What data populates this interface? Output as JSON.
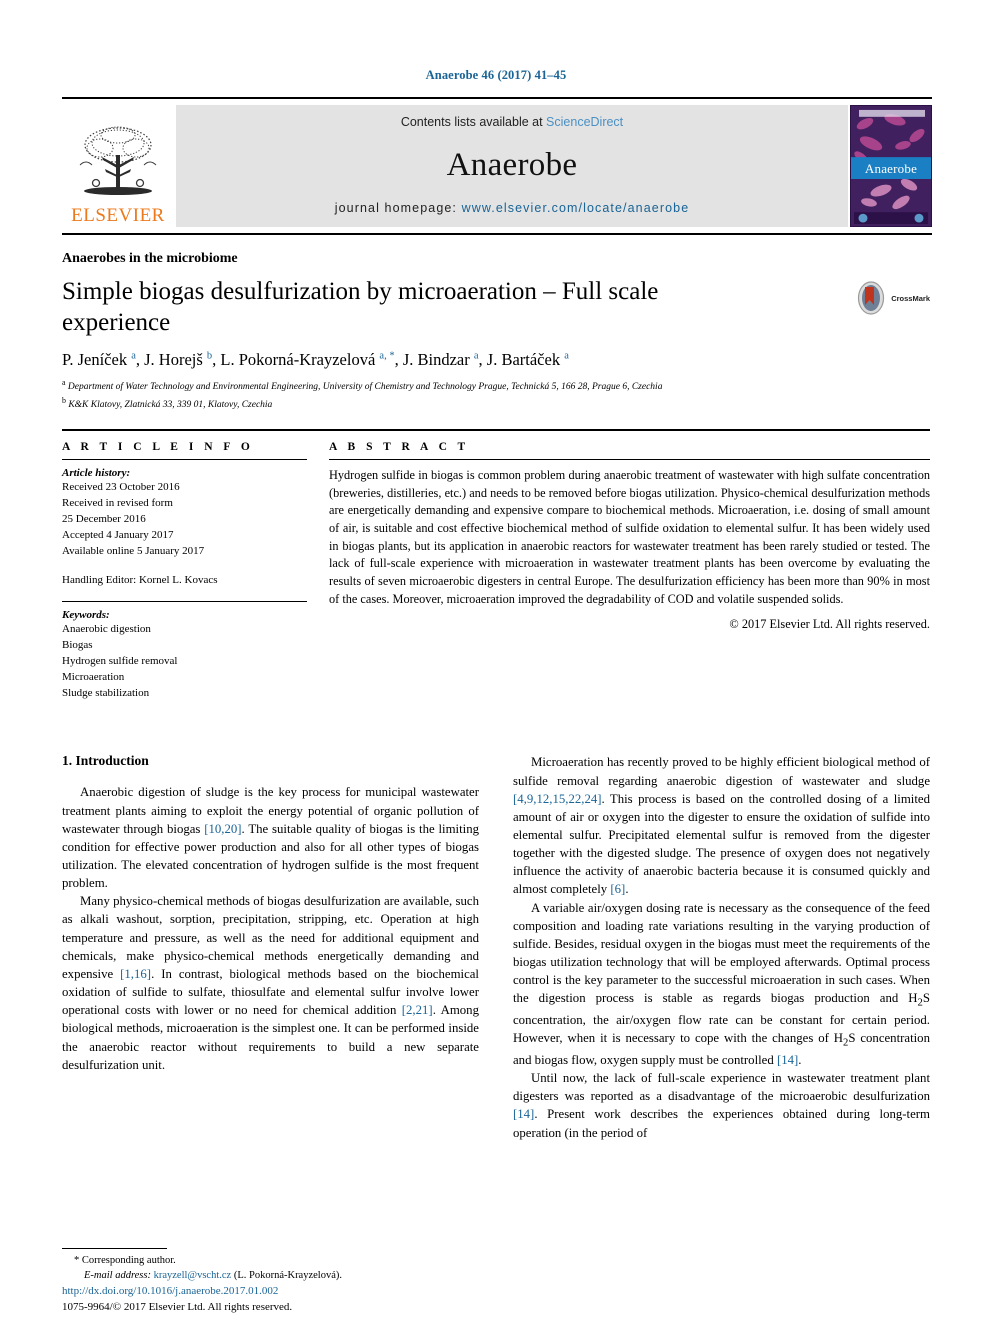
{
  "running_head": "Anaerobe 46 (2017) 41–45",
  "header": {
    "publisher": "ELSEVIER",
    "contents_prefix": "Contents lists available at ",
    "contents_link": "ScienceDirect",
    "journal_name": "Anaerobe",
    "homepage_prefix": "journal homepage: ",
    "homepage_url": "www.elsevier.com/locate/anaerobe",
    "cover_title": "Anaerobe",
    "link_color": "#1a6496",
    "band_background": "#e3e3e3"
  },
  "article": {
    "kicker": "Anaerobes in the microbiome",
    "title": "Simple biogas desulfurization by microaeration – Full scale experience",
    "crossmark_label": "CrossMark",
    "authors_html": "P. Jeníček <sup>a</sup>, J. Horejš <sup>b</sup>, L. Pokorná-Krayzelová <sup>a, *</sup>, J. Bindzar <sup>a</sup>, J. Bartáček <sup>a</sup>",
    "affiliation_a": "Department of Water Technology and Environmental Engineering, University of Chemistry and Technology Prague, Technická 5, 166 28, Prague 6, Czechia",
    "affiliation_b": "K&K Klatovy, Zlatnická 33, 339 01, Klatovy, Czechia"
  },
  "article_info": {
    "heading": "A R T I C L E  I N F O",
    "history_label": "Article history:",
    "history": [
      "Received 23 October 2016",
      "Received in revised form",
      "25 December 2016",
      "Accepted 4 January 2017",
      "Available online 5 January 2017"
    ],
    "handling_editor": "Handling Editor: Kornel L. Kovacs",
    "keywords_label": "Keywords:",
    "keywords": [
      "Anaerobic digestion",
      "Biogas",
      "Hydrogen sulfide removal",
      "Microaeration",
      "Sludge stabilization"
    ]
  },
  "abstract": {
    "heading": "A B S T R A C T",
    "text": "Hydrogen sulfide in biogas is common problem during anaerobic treatment of wastewater with high sulfate concentration (breweries, distilleries, etc.) and needs to be removed before biogas utilization. Physico-chemical desulfurization methods are energetically demanding and expensive compare to biochemical methods. Microaeration, i.e. dosing of small amount of air, is suitable and cost effective biochemical method of sulfide oxidation to elemental sulfur. It has been widely used in biogas plants, but its application in anaerobic reactors for wastewater treatment has been rarely studied or tested. The lack of full-scale experience with microaeration in wastewater treatment plants has been overcome by evaluating the results of seven microaerobic digesters in central Europe. The desulfurization efficiency has been more than 90% in most of the cases. Moreover, microaeration improved the degradability of COD and volatile suspended solids.",
    "copyright": "© 2017 Elsevier Ltd. All rights reserved."
  },
  "body": {
    "section_number_title": "1. Introduction",
    "left_paragraphs_html": [
      "Anaerobic digestion of sludge is the key process for municipal wastewater treatment plants aiming to exploit the energy potential of organic pollution of wastewater through biogas <span class=\"ref\">[10,20]</span>. The suitable quality of biogas is the limiting condition for effective power production and also for all other types of biogas utilization. The elevated concentration of hydrogen sulfide is the most frequent problem.",
      "Many physico-chemical methods of biogas desulfurization are available, such as alkali washout, sorption, precipitation, stripping, etc. Operation at high temperature and pressure, as well as the need for additional equipment and chemicals, make physico-chemical methods energetically demanding and expensive <span class=\"ref\">[1,16]</span>. In contrast, biological methods based on the biochemical oxidation of sulfide to sulfate, thiosulfate and elemental sulfur involve lower operational costs with lower or no need for chemical addition <span class=\"ref\">[2,21]</span>. Among biological methods, microaeration is the simplest one. It can be performed inside the anaerobic reactor without requirements to build a new separate desulfurization unit."
    ],
    "right_paragraphs_html": [
      "Microaeration has recently proved to be highly efficient biological method of sulfide removal regarding anaerobic digestion of wastewater and sludge <span class=\"ref\">[4,9,12,15,22,24]</span>. This process is based on the controlled dosing of a limited amount of air or oxygen into the digester to ensure the oxidation of sulfide into elemental sulfur. Precipitated elemental sulfur is removed from the digester together with the digested sludge. The presence of oxygen does not negatively influence the activity of anaerobic bacteria because it is consumed quickly and almost completely <span class=\"ref\">[6]</span>.",
      "A variable air/oxygen dosing rate is necessary as the consequence of the feed composition and loading rate variations resulting in the varying production of sulfide. Besides, residual oxygen in the biogas must meet the requirements of the biogas utilization technology that will be employed afterwards. Optimal process control is the key parameter to the successful microaeration in such cases. When the digestion process is stable as regards biogas production and H<sub>2</sub>S concentration, the air/oxygen flow rate can be constant for certain period. However, when it is necessary to cope with the changes of H<sub>2</sub>S concentration and biogas flow, oxygen supply must be controlled <span class=\"ref\">[14]</span>.",
      "Until now, the lack of full-scale experience in wastewater treatment plant digesters was reported as a disadvantage of the microaerobic desulfurization <span class=\"ref\">[14]</span>. Present work describes the experiences obtained during long-term operation (in the period of"
    ]
  },
  "footnote": {
    "corresponding_marker": "*",
    "corresponding_text": "Corresponding author.",
    "email_label": "E-mail address:",
    "email": "krayzell@vscht.cz",
    "email_owner": "(L. Pokorná-Krayzelová).",
    "doi_url": "http://dx.doi.org/10.1016/j.anaerobe.2017.01.002",
    "issn_line": "1075-9964/© 2017 Elsevier Ltd. All rights reserved."
  }
}
